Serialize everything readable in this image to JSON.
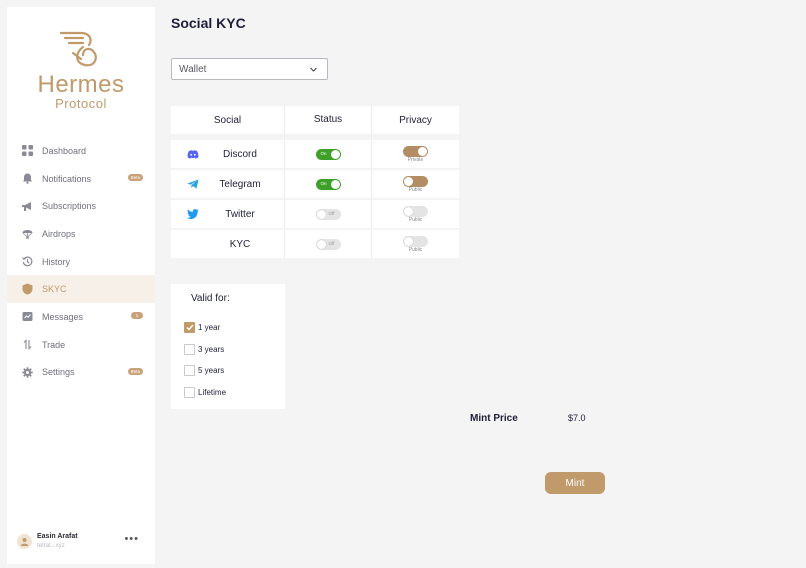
{
  "brand": {
    "name": "Hermes",
    "subtitle": "Protocol",
    "color": "#c09a6b"
  },
  "sidebar": {
    "items": [
      {
        "label": "Dashboard",
        "icon": "grid-icon"
      },
      {
        "label": "Notifications",
        "icon": "bell-icon",
        "badge": "Beta"
      },
      {
        "label": "Subscriptions",
        "icon": "megaphone-icon"
      },
      {
        "label": "Airdrops",
        "icon": "parachute-icon"
      },
      {
        "label": "History",
        "icon": "history-icon"
      },
      {
        "label": "SKYC",
        "icon": "shield-icon",
        "active": true
      },
      {
        "label": "Messages",
        "icon": "messages-icon",
        "badge": "1"
      },
      {
        "label": "Trade",
        "icon": "trade-icon"
      },
      {
        "label": "Settings",
        "icon": "gear-icon",
        "badge": "Beta"
      }
    ]
  },
  "user": {
    "name": "Easin Arafat",
    "subtitle": "tetrat...xyz"
  },
  "main": {
    "title": "Social KYC",
    "wallet_select": {
      "value": "Wallet"
    },
    "table": {
      "headers": {
        "social": "Social",
        "status": "Status",
        "privacy": "Privacy"
      },
      "rows": [
        {
          "name": "Discord",
          "icon": "discord-icon",
          "status": "On",
          "privacy": "Private"
        },
        {
          "name": "Telegram",
          "icon": "telegram-icon",
          "status": "On",
          "privacy": "Public"
        },
        {
          "name": "Twitter",
          "icon": "twitter-icon",
          "status": "Off",
          "privacy": "Public"
        },
        {
          "name": "KYC",
          "icon": "",
          "status": "Off",
          "privacy": "Public"
        }
      ]
    },
    "valid_for": {
      "title": "Valid for:",
      "options": [
        {
          "label": "1 year",
          "checked": true
        },
        {
          "label": "3 years",
          "checked": false
        },
        {
          "label": "5 years",
          "checked": false
        },
        {
          "label": "Lifetime",
          "checked": false
        }
      ]
    },
    "mint": {
      "price_label": "Mint Price",
      "price_value": "$7.0",
      "button_label": "Mint"
    }
  },
  "colors": {
    "accent": "#c09a6b",
    "toggle_on": "#3da028",
    "toggle_off": "#e4e4e4",
    "background": "#f4f4f4"
  }
}
